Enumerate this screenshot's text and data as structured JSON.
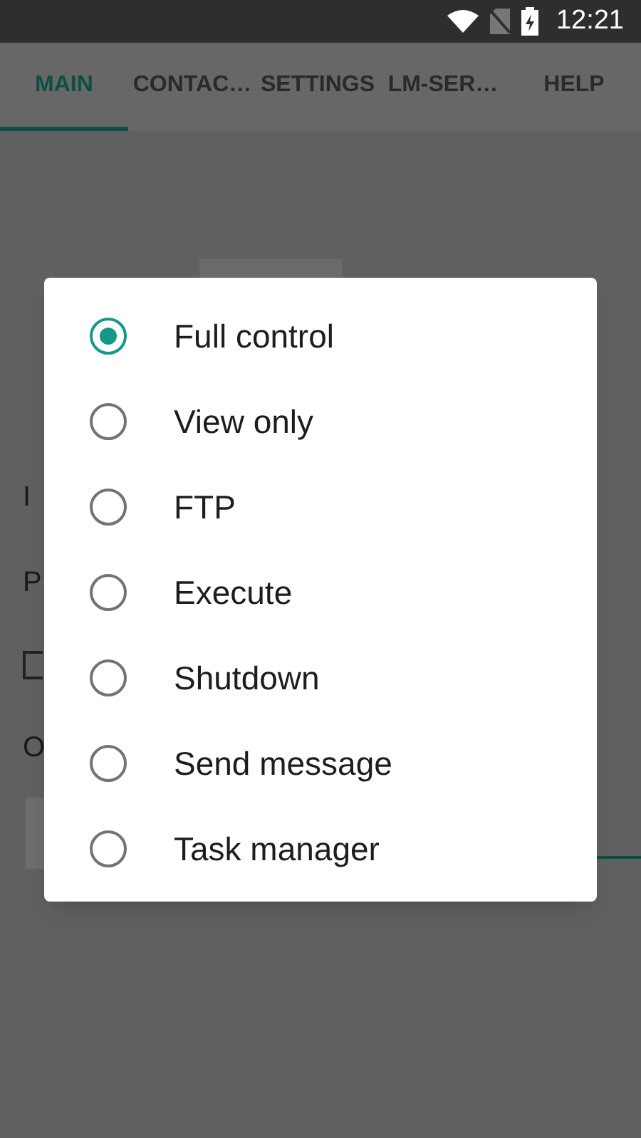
{
  "status_bar": {
    "time": "12:21"
  },
  "tabs": [
    {
      "label": "MAIN",
      "selected": true
    },
    {
      "label": "CONTAC…",
      "selected": false
    },
    {
      "label": "SETTINGS",
      "selected": false
    },
    {
      "label": "LM-SER…",
      "selected": false
    },
    {
      "label": "HELP",
      "selected": false
    }
  ],
  "form": {
    "labels": [
      "I",
      "P"
    ],
    "checkbox": {
      "checked": false
    },
    "label_3": "O"
  },
  "dialog": {
    "options": [
      {
        "label": "Full control",
        "selected": true
      },
      {
        "label": "View only",
        "selected": false
      },
      {
        "label": "FTP",
        "selected": false
      },
      {
        "label": "Execute",
        "selected": false
      },
      {
        "label": "Shutdown",
        "selected": false
      },
      {
        "label": "Send message",
        "selected": false
      },
      {
        "label": "Task manager",
        "selected": false
      }
    ]
  }
}
